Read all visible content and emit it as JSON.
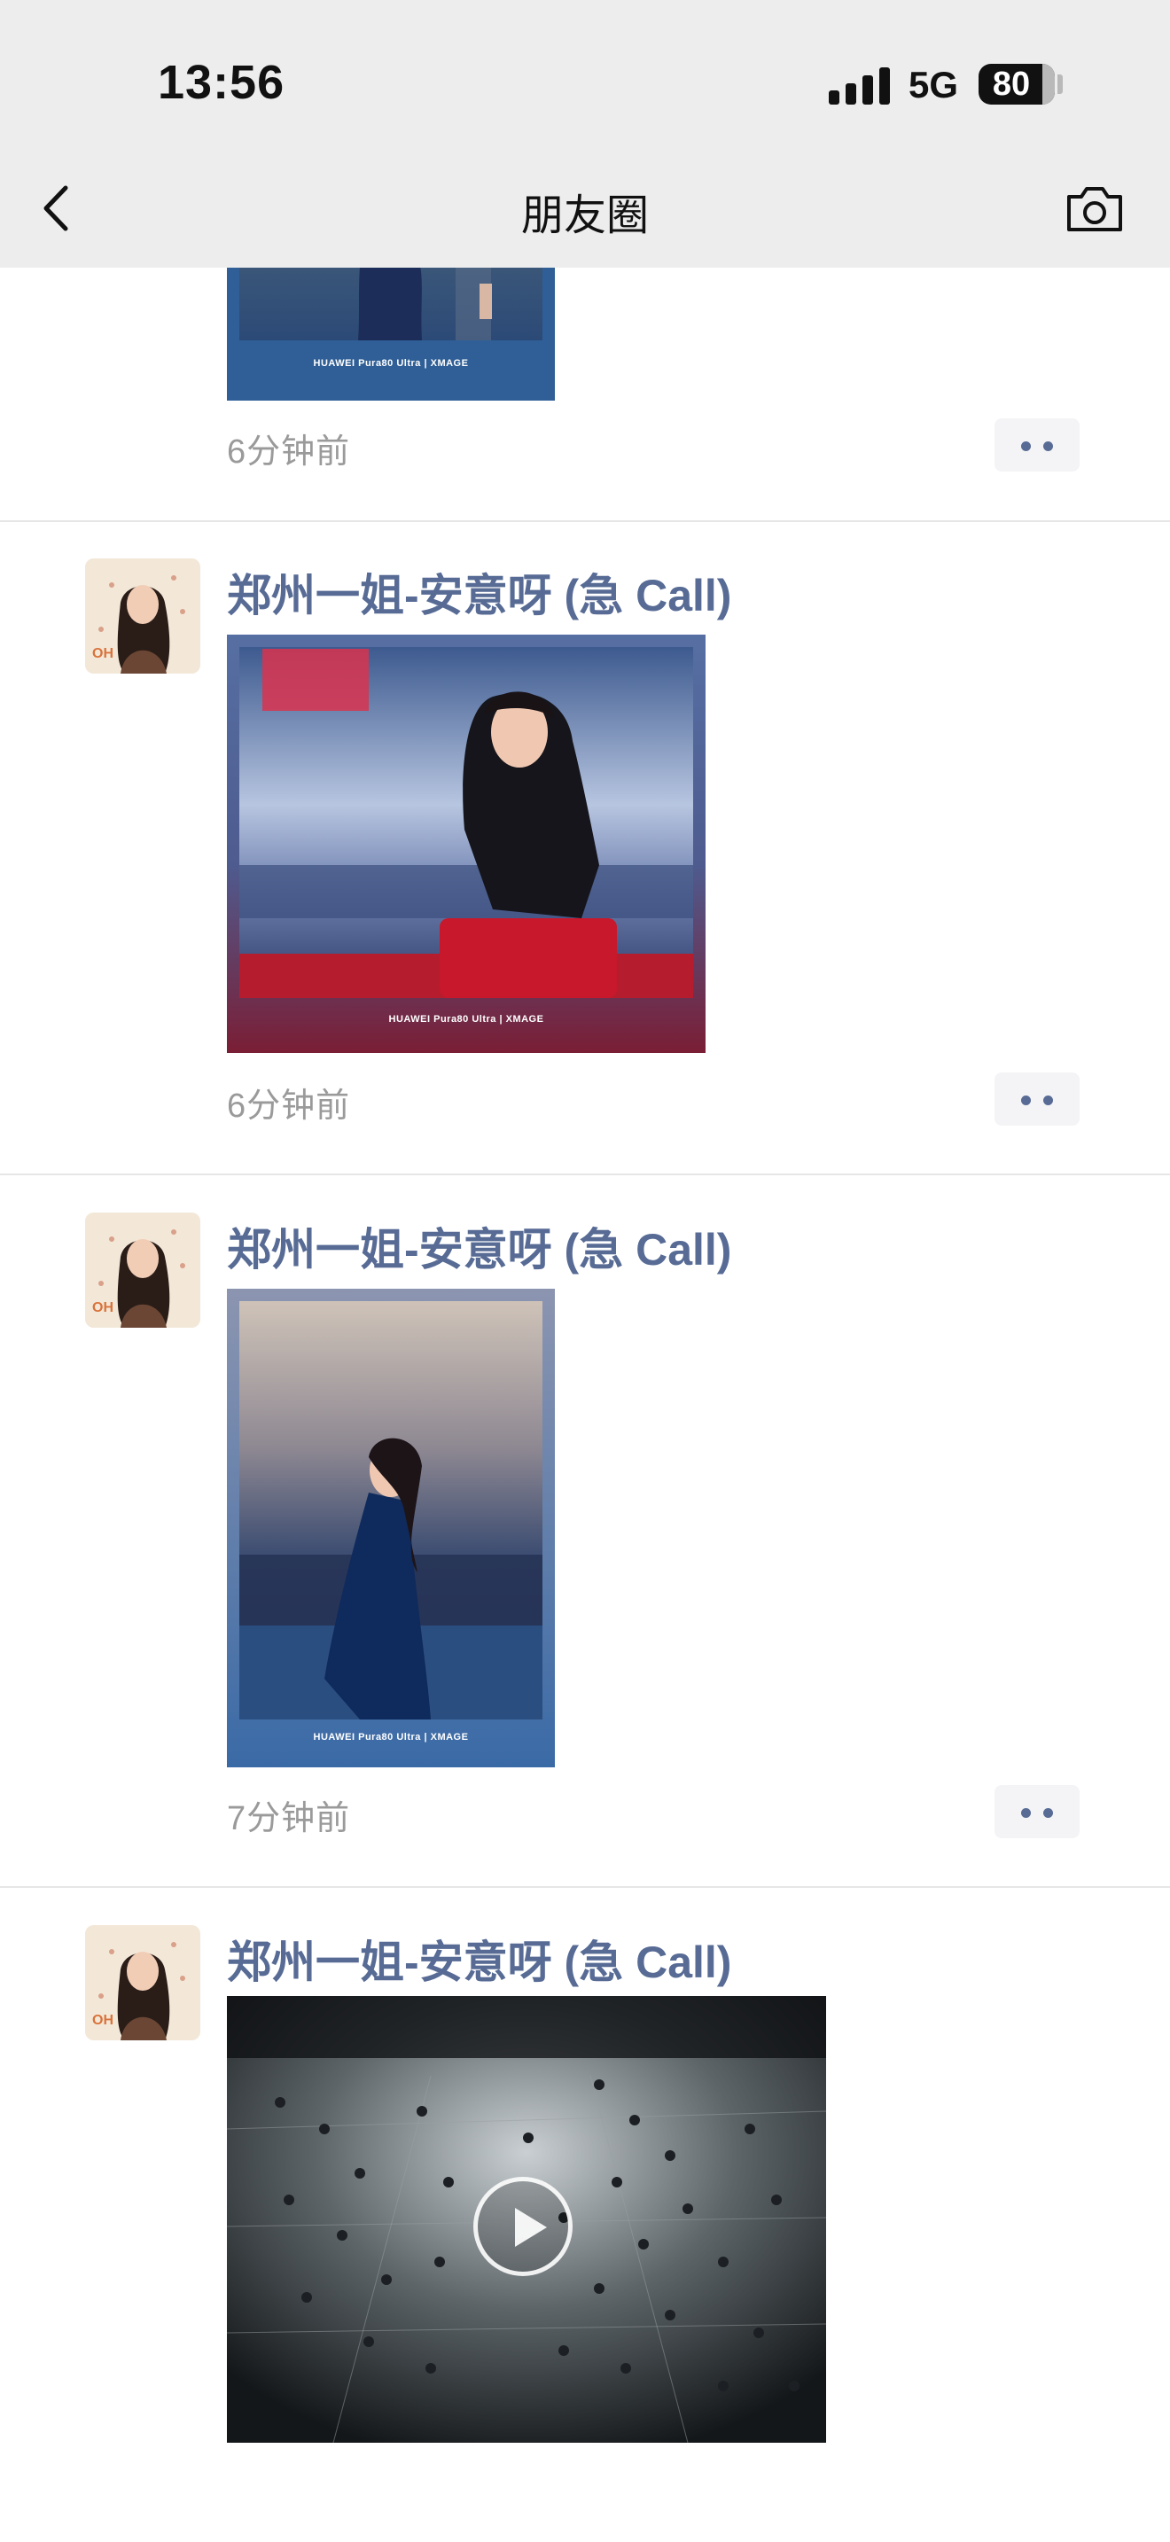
{
  "status_bar": {
    "time": "13:56",
    "network": "5G",
    "battery": "80"
  },
  "nav": {
    "title": "朋友圈",
    "back_icon": "chevron-left-icon",
    "camera_icon": "camera-icon"
  },
  "posts": [
    {
      "time": "6分钟前",
      "photo_caption": "HUAWEI Pura80 Ultra | XMAGE"
    },
    {
      "username": "郑州一姐-安意呀 (急 Call)",
      "time": "6分钟前",
      "photo_caption": "HUAWEI Pura80 Ultra | XMAGE"
    },
    {
      "username": "郑州一姐-安意呀 (急 Call)",
      "time": "7分钟前",
      "photo_caption": "HUAWEI Pura80 Ultra | XMAGE"
    },
    {
      "username": "郑州一姐-安意呀 (急 Call)",
      "media_type": "video",
      "play_icon": "play-icon"
    }
  ],
  "colors": {
    "username": "#576b95",
    "time": "#9a9a9a",
    "topbar": "#ededed"
  }
}
